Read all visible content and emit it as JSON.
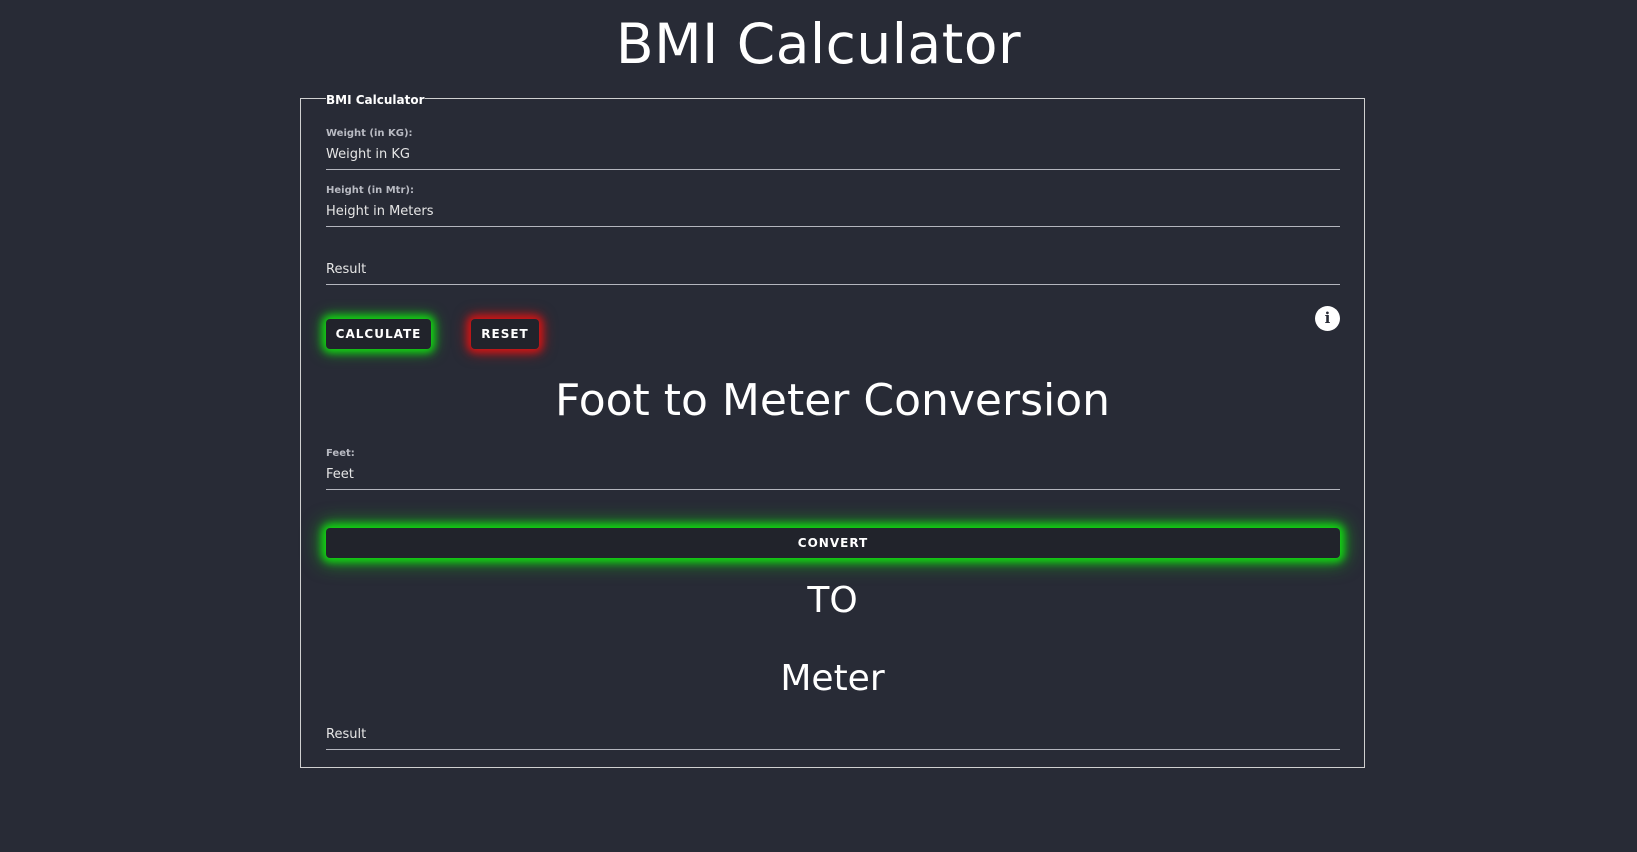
{
  "page": {
    "title": "BMI Calculator"
  },
  "bmi_form": {
    "legend": "BMI Calculator",
    "weight_label": "Weight (in KG):",
    "weight_placeholder": "Weight in KG",
    "height_label": "Height (in Mtr):",
    "height_placeholder": "Height in Meters",
    "result_placeholder": "Result",
    "calculate_label": "CALCULATE",
    "reset_label": "RESET",
    "info_icon": "info-icon"
  },
  "conversion": {
    "title": "Foot to Meter Conversion",
    "feet_label": "Feet:",
    "feet_placeholder": "Feet",
    "convert_label": "CONVERT",
    "to_text": "TO",
    "unit_text": "Meter",
    "result_placeholder": "Result"
  },
  "colors": {
    "background": "#282b36",
    "button_bg": "#21232b",
    "glow_green": "#12d612",
    "glow_red": "#d41414",
    "text": "#ffffff"
  }
}
